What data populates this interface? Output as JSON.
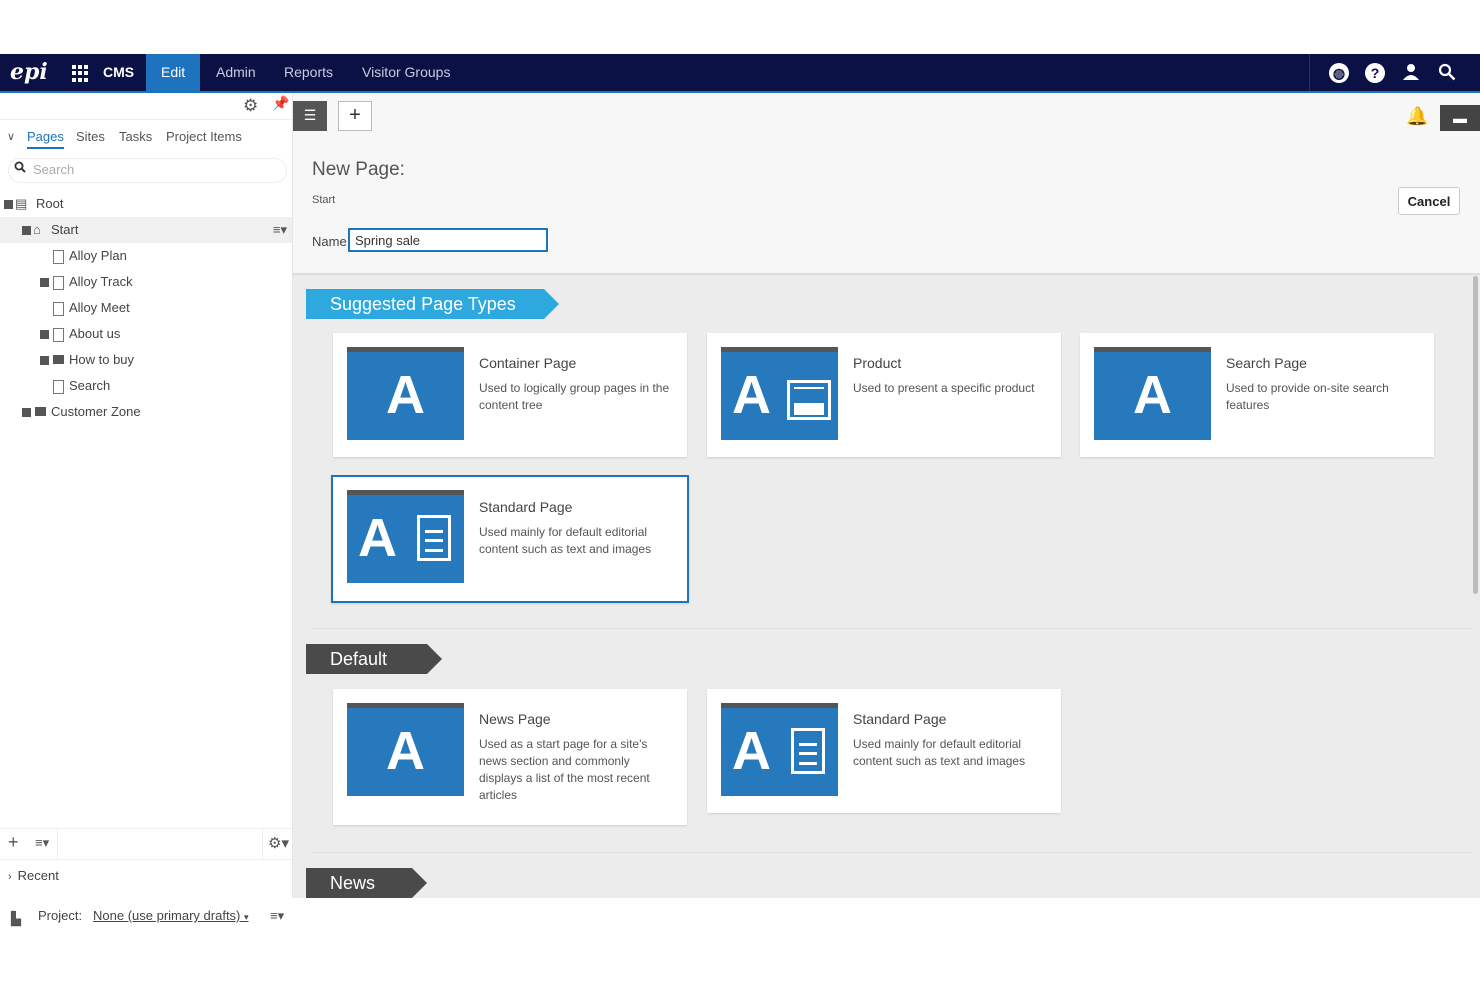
{
  "topnav": {
    "logo": "epi",
    "product": "CMS",
    "items": [
      {
        "label": "Edit",
        "active": true
      },
      {
        "label": "Admin",
        "active": false
      },
      {
        "label": "Reports",
        "active": false
      },
      {
        "label": "Visitor Groups",
        "active": false
      }
    ],
    "right_icons": [
      "globe-icon",
      "help-icon",
      "user-icon",
      "search-icon"
    ]
  },
  "left_panel": {
    "tabs": [
      "Pages",
      "Sites",
      "Tasks",
      "Project Items"
    ],
    "selected_tab": "Pages",
    "search_placeholder": "Search",
    "tree": [
      {
        "label": "Root"
      },
      {
        "label": "Start"
      },
      {
        "label": "Alloy Plan"
      },
      {
        "label": "Alloy Track"
      },
      {
        "label": "Alloy Meet"
      },
      {
        "label": "About us"
      },
      {
        "label": "How to buy"
      },
      {
        "label": "Search"
      },
      {
        "label": "Customer Zone"
      }
    ],
    "recent_label": "Recent"
  },
  "project_bar": {
    "label": "Project:",
    "value": "None (use primary drafts)"
  },
  "main": {
    "title": "New Page:",
    "breadcrumb": "Start",
    "cancel_label": "Cancel",
    "name_label": "Name",
    "name_value": "Spring sale",
    "sections": [
      {
        "title": "Suggested Page Types",
        "cards": [
          {
            "title": "Container Page",
            "desc": "Used to logically group pages in the content tree",
            "icon": "container-page-icon"
          },
          {
            "title": "Product",
            "desc": "Used to present a specific product",
            "icon": "product-page-icon"
          },
          {
            "title": "Search Page",
            "desc": "Used to provide on-site search features",
            "icon": "search-page-icon"
          },
          {
            "title": "Standard Page",
            "desc": "Used mainly for default editorial content such as text and images",
            "icon": "standard-page-icon"
          }
        ]
      },
      {
        "title": "Default",
        "cards": [
          {
            "title": "News Page",
            "desc": "Used as a start page for a site's news section and commonly displays a list of the most recent articles",
            "icon": "news-page-icon"
          },
          {
            "title": "Standard Page",
            "desc": "Used mainly for default editorial content such as text and images",
            "icon": "standard-page-icon"
          }
        ]
      },
      {
        "title": "News",
        "cards": []
      }
    ]
  },
  "colors": {
    "nav_bg": "#0b1145",
    "accent": "#1e73be",
    "ribbon_blue": "#2ea9e0",
    "ribbon_gray": "#4a4a4a",
    "thumb_blue": "#2779bd"
  }
}
